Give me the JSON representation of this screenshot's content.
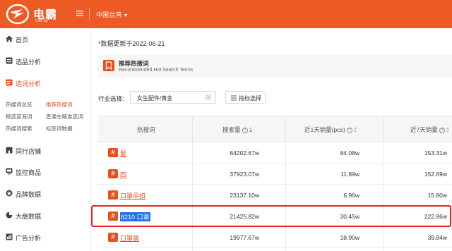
{
  "header": {
    "logo_text": "电霸",
    "logo_sub": "Dian Ba",
    "region": "中国台湾",
    "brand_color": "#ee5a24"
  },
  "sidebar": {
    "items": [
      {
        "label": "首页",
        "icon": "home-icon",
        "active": false
      },
      {
        "label": "选品分析",
        "icon": "product-analysis-icon",
        "active": false
      },
      {
        "label": "选词分析",
        "icon": "keyword-analysis-icon",
        "active": true
      },
      {
        "label": "同行店铺",
        "icon": "store-icon",
        "active": false
      },
      {
        "label": "监控商品",
        "icon": "monitor-icon",
        "active": false
      },
      {
        "label": "品牌数据",
        "icon": "brand-icon",
        "active": false
      },
      {
        "label": "大盘数据",
        "icon": "market-icon",
        "active": false
      },
      {
        "label": "广告分析",
        "icon": "ad-analysis-icon",
        "active": false
      }
    ],
    "subitems": [
      {
        "label": "热搜词总览",
        "active": false
      },
      {
        "label": "推荐热搜词",
        "active": true
      },
      {
        "label": "精选蓝海词",
        "active": false
      },
      {
        "label": "直通车精准选词",
        "active": false
      },
      {
        "label": "热搜词搜索",
        "active": false
      },
      {
        "label": "标签词数据",
        "active": false
      }
    ]
  },
  "main": {
    "updated": "*数据更新于2022-06-21",
    "banner_title": "推荐热搜词",
    "banner_subtitle": "Recommended Hot Search Terms",
    "filter_label": "行业选择：",
    "filter_value": "女生配件/黄金",
    "metric_button": "指标选择"
  },
  "table": {
    "columns": [
      "热搜词",
      "搜索量",
      "近1天销量(pcs)",
      "近7天销量"
    ],
    "rows": [
      {
        "keyword": "髮",
        "search": "64202.67w",
        "sales1d": "84.08w",
        "sales7d": "153.31w"
      },
      {
        "keyword": "四",
        "search": "37923.07w",
        "sales1d": "11.89w",
        "sales7d": "152.69w"
      },
      {
        "keyword": "口罩吊扣",
        "search": "23137.10w",
        "sales1d": "6.96w",
        "sales7d": "15.80w"
      },
      {
        "keyword": "8210 口罩",
        "search": "21425.82w",
        "sales1d": "30.45w",
        "sales7d": "222.86w",
        "selected": true
      },
      {
        "keyword": "口罩袋",
        "search": "19977.67w",
        "sales1d": "18.90w",
        "sales7d": "39.84w"
      }
    ],
    "accent": "#e8501d",
    "highlight_color": "#e5231b"
  }
}
